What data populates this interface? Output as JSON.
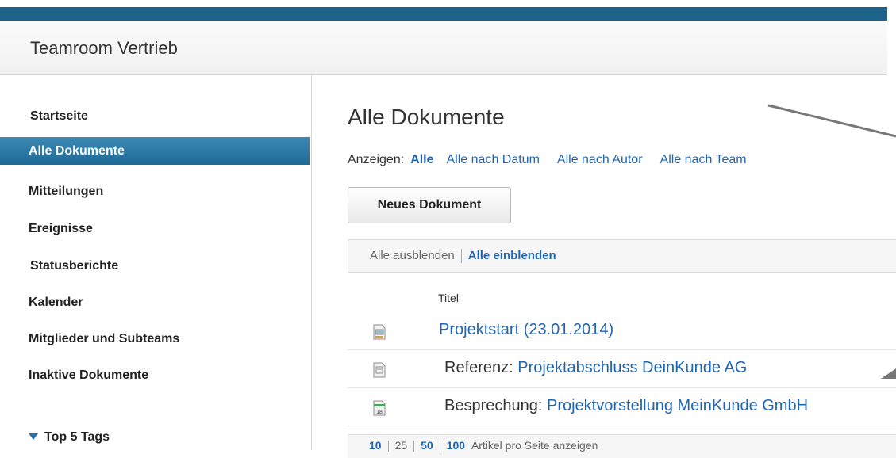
{
  "app": {
    "title": "Teamroom Vertrieb"
  },
  "sidebar": {
    "items": [
      {
        "label": "Startseite"
      },
      {
        "label": "Alle Dokumente"
      },
      {
        "label": "Mitteilungen"
      },
      {
        "label": "Ereignisse"
      },
      {
        "label": "Statusberichte"
      },
      {
        "label": "Kalender"
      },
      {
        "label": "Mitglieder und Subteams"
      },
      {
        "label": "Inaktive Dokumente"
      }
    ],
    "active_index": 1,
    "tags_label": "Top 5 Tags"
  },
  "main": {
    "title": "Alle Dokumente",
    "filter_prefix": "Anzeigen:",
    "filters": [
      "Alle",
      "Alle nach Datum",
      "Alle nach Autor",
      "Alle nach Team"
    ],
    "new_document_label": "Neues Dokument",
    "collapse_all_label": "Alle ausblenden",
    "expand_all_label": "Alle einblenden",
    "column_title": "Titel",
    "documents": [
      {
        "prefix": "",
        "title": "Projektstart (23.01.2014)",
        "icon": "presentation-icon"
      },
      {
        "prefix": "Referenz:",
        "title": "Projektabschluss DeinKunde AG",
        "icon": "document-icon"
      },
      {
        "prefix": "Besprechung:",
        "title": "Projektvorstellung MeinKunde GmbH",
        "icon": "calendar-icon",
        "icon_text": "18"
      }
    ],
    "pager": {
      "sizes": [
        "10",
        "25",
        "50",
        "100"
      ],
      "label": "Artikel pro Seite anzeigen"
    }
  },
  "colors": {
    "accent": "#1c6289",
    "link": "#1f65b0",
    "active_nav": "#2a78a6"
  }
}
